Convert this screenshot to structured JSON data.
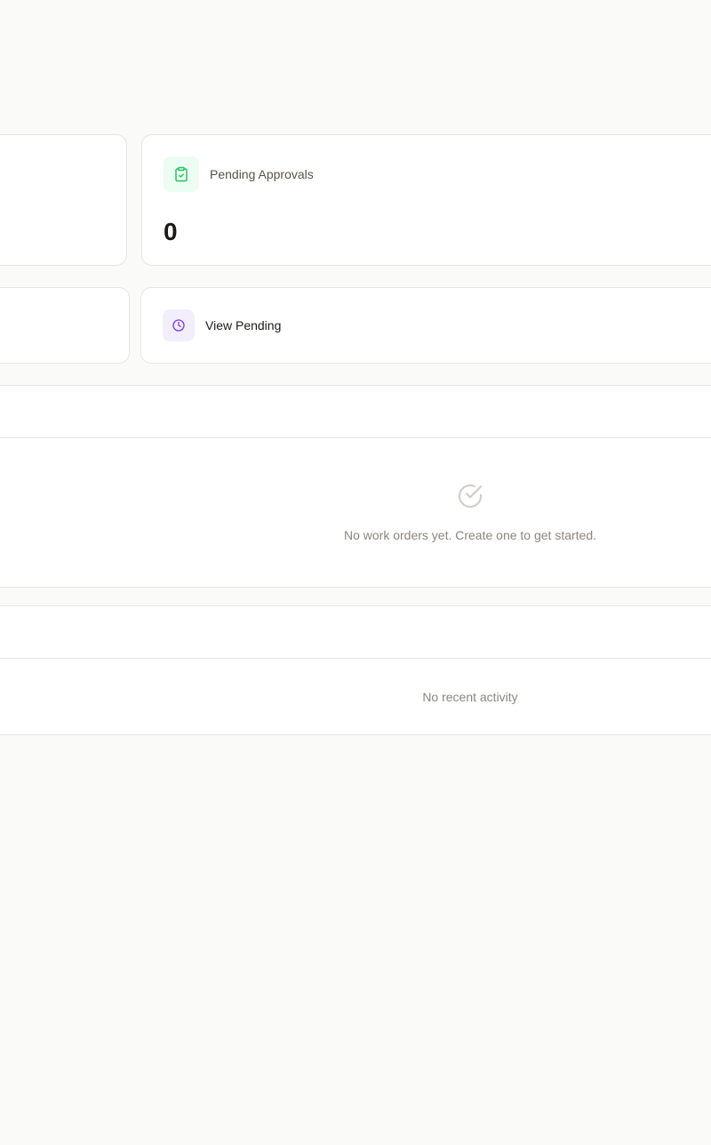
{
  "stats": {
    "pending_approvals": {
      "label": "Pending Approvals",
      "value": "0",
      "icon": "clipboard-check-icon",
      "accent": "#22c55e"
    }
  },
  "quick_actions": {
    "view_pending": {
      "label": "View Pending",
      "icon": "clock-icon",
      "accent": "#7c3aed"
    }
  },
  "work_orders": {
    "empty_message": "No work orders yet. Create one to get started.",
    "empty_icon": "check-circle-icon"
  },
  "recent_activity": {
    "empty_message": "No recent activity"
  }
}
